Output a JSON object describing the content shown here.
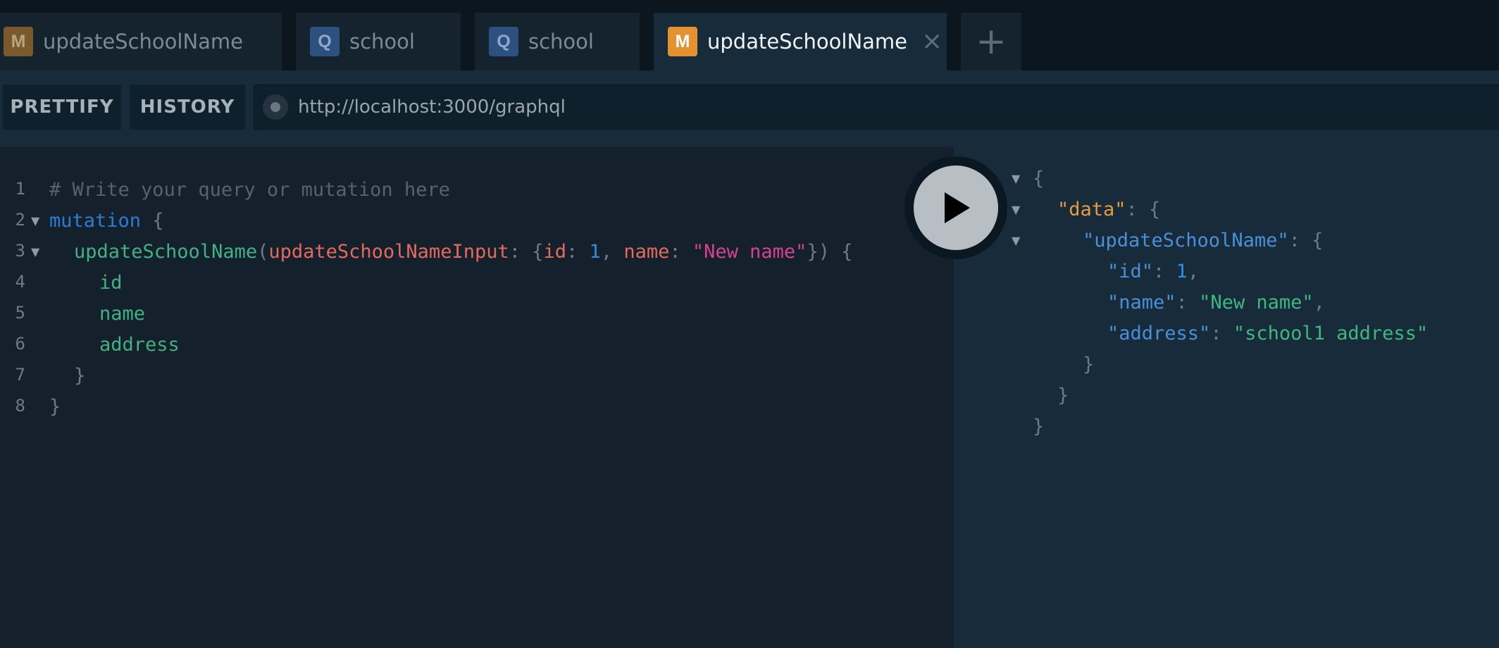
{
  "tabs": [
    {
      "badge": "M",
      "title": "updateSchoolName"
    },
    {
      "badge": "Q",
      "title": "school"
    },
    {
      "badge": "Q",
      "title": "school"
    },
    {
      "badge": "M",
      "title": "updateSchoolName",
      "close": "×"
    }
  ],
  "add_tab": "+",
  "toolbar": {
    "prettify": "PRETTIFY",
    "history": "HISTORY",
    "endpoint": "http://localhost:3000/graphql"
  },
  "editor": {
    "line_numbers": [
      "1",
      "2",
      "3",
      "4",
      "5",
      "6",
      "7",
      "8"
    ],
    "l1_comment": "# Write your query or mutation here",
    "l2_keyword": "mutation",
    "l2_brace": " {",
    "l3_field": "updateSchoolName",
    "l3_paren": "(",
    "l3_arg": "updateSchoolNameInput",
    "l3_colon": ": {",
    "l3_id_key": "id",
    "l3_id_colon": ": ",
    "l3_id_val": "1",
    "l3_comma": ", ",
    "l3_name_key": "name",
    "l3_name_colon": ": ",
    "l3_name_val": "\"New name\"",
    "l3_close": "}) {",
    "l4_field": "id",
    "l5_field": "name",
    "l6_field": "address",
    "l7_brace": "}",
    "l8_brace": "}"
  },
  "result": {
    "open": "{",
    "data_key": "\"data\"",
    "data_sep": ": {",
    "usn_key": "\"updateSchoolName\"",
    "usn_sep": ": {",
    "id_key": "\"id\"",
    "id_sep": ": ",
    "id_val": "1",
    "comma": ",",
    "name_key": "\"name\"",
    "name_sep": ": ",
    "name_val": "\"New name\"",
    "address_key": "\"address\"",
    "address_sep": ": ",
    "address_val": "\"school1 address\"",
    "close1": "}",
    "close2": "}",
    "close3": "}"
  },
  "icons": {
    "run": "play-icon",
    "url_status": "status-dot-icon",
    "fold": "triangle-down-icon",
    "close": "close-icon",
    "add": "plus-icon"
  }
}
